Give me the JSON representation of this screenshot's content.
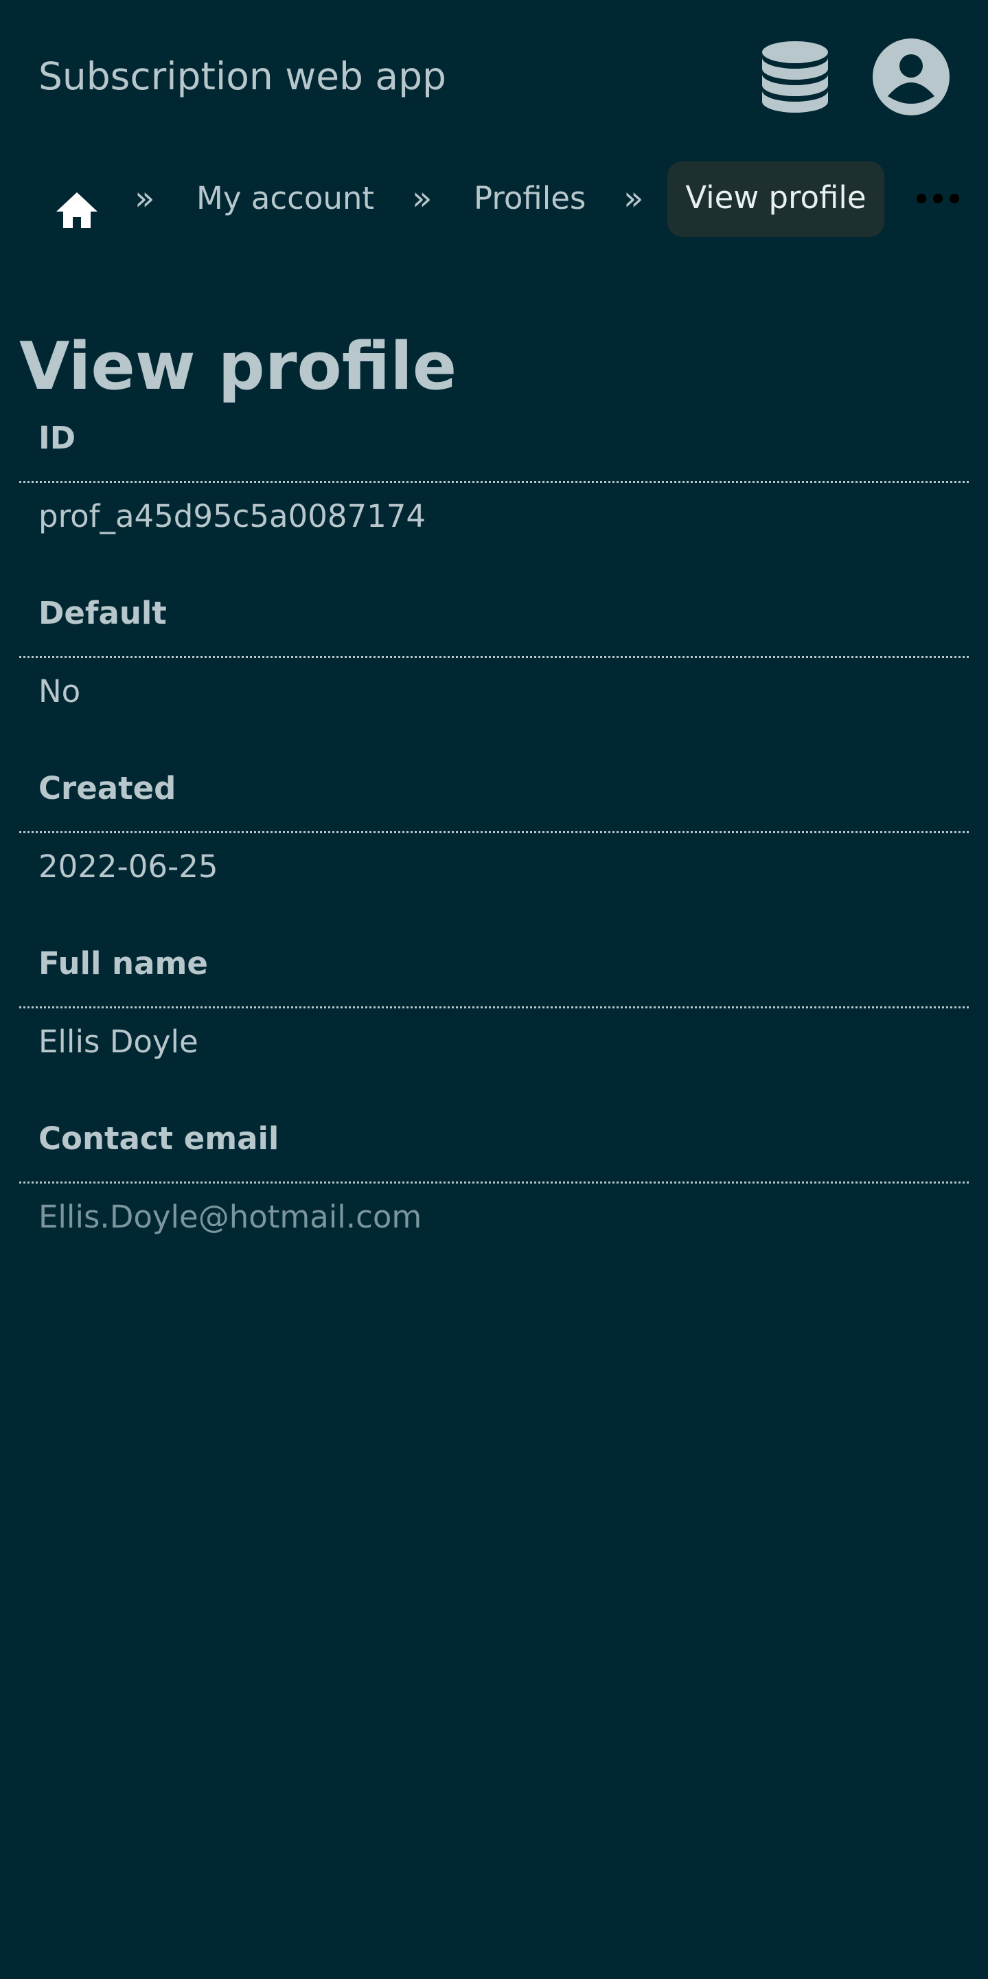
{
  "header": {
    "app_title": "Subscription web app",
    "icons": [
      "database-icon",
      "user-circle-icon"
    ]
  },
  "breadcrumb": {
    "items": [
      {
        "label": "",
        "icon": "home-icon"
      },
      {
        "label": "My account"
      },
      {
        "label": "Profiles"
      },
      {
        "label": "View profile",
        "current": true
      }
    ],
    "separator": "»",
    "more_icon": "more-dots-icon"
  },
  "page": {
    "title": "View profile"
  },
  "fields": [
    {
      "label": "ID",
      "value": "prof_a45d95c5a0087174"
    },
    {
      "label": "Default",
      "value": "No"
    },
    {
      "label": "Created",
      "value": "2022-06-25"
    },
    {
      "label": "Full name",
      "value": "Ellis Doyle"
    },
    {
      "label": "Contact email",
      "value": "Ellis.Doyle@hotmail.com"
    }
  ],
  "colors": {
    "background": "#012732",
    "text": "#b8c7cc",
    "current_crumb_bg": "#1d302f",
    "link": "#7b969e"
  }
}
